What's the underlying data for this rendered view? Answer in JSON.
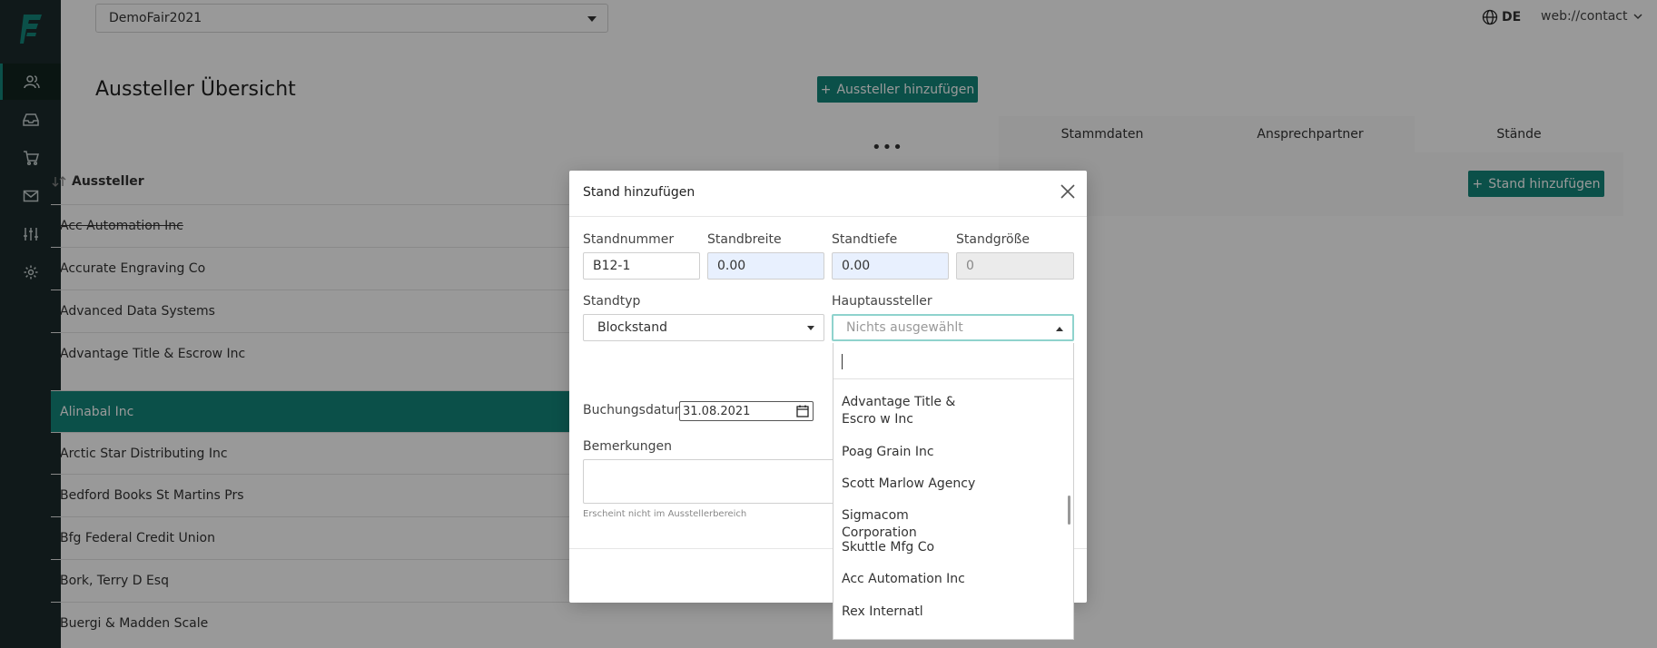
{
  "colors": {
    "accent": "#13857a",
    "sidebar": "#1b2b2c"
  },
  "header": {
    "fair": "DemoFair2021",
    "lang": "DE",
    "user": "web://contact"
  },
  "sidebar": {
    "icons": [
      "users-icon",
      "inbox-icon",
      "cart-icon",
      "mail-icon",
      "sliders-icon",
      "gear-icon"
    ]
  },
  "page": {
    "title": "Aussteller Übersicht",
    "add_exhibitor": "Aussteller hinzufügen"
  },
  "list": {
    "header": "Aussteller",
    "rows": [
      "Acc Automation Inc",
      "Accurate Engraving Co",
      "Advanced Data Systems",
      "Advantage Title & Escrow Inc",
      "Alinabal Inc",
      "Arctic Star Distributing Inc",
      "Bedford Books St Martins Prs",
      "Bfg Federal Credit Union",
      "Bork, Terry D Esq",
      "Buergi & Madden Scale"
    ]
  },
  "detail": {
    "tabs": [
      "Stammdaten",
      "Ansprechpartner",
      "Stände"
    ],
    "add_stand": "Stand hinzufügen"
  },
  "modal": {
    "title": "Stand hinzufügen",
    "standnummer_label": "Standnummer",
    "standnummer": "B12-1",
    "standbreite_label": "Standbreite",
    "standbreite": "0.00",
    "standtiefe_label": "Standtiefe",
    "standtiefe": "0.00",
    "standgroesse_label": "Standgröße",
    "standgroesse": "0",
    "standtyp_label": "Standtyp",
    "standtyp": "Blockstand",
    "hauptaussteller_label": "Hauptaussteller",
    "hauptaussteller_placeholder": "Nichts ausgewählt",
    "buchungsdatum_label": "Buchungsdatum",
    "buchungsdatum": "31.08.2021",
    "bemerkungen_label": "Bemerkungen",
    "bemerkungen_hint": "Erscheint nicht im Ausstellerbereich"
  },
  "dropdown": {
    "items": [
      "Advantage Title & Escro w Inc",
      "Poag Grain Inc",
      "Scott Marlow Agency",
      "Sigmacom Corporation",
      "Skuttle Mfg Co",
      "Acc Automation Inc",
      "Rex Internatl"
    ]
  }
}
